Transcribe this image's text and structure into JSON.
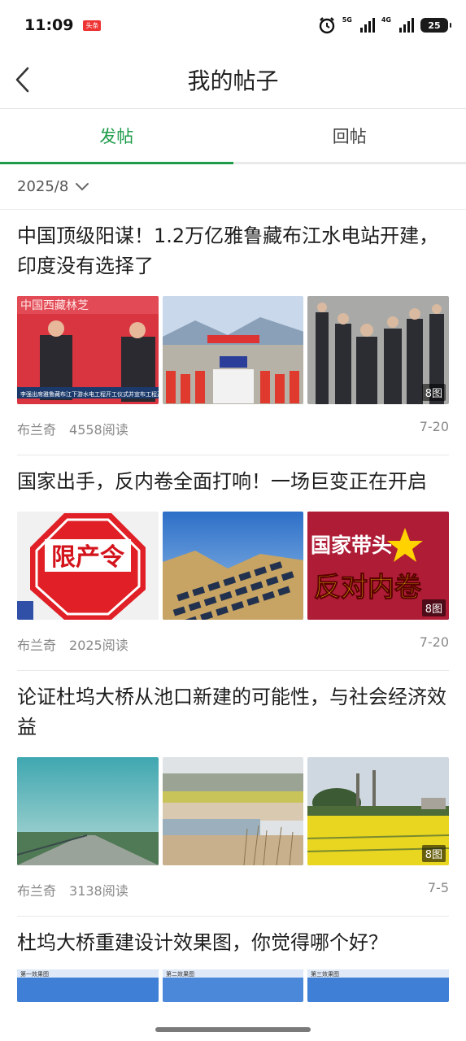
{
  "status": {
    "time": "11:09",
    "app_badge": "头条",
    "net1": "5G",
    "net2": "4G",
    "battery": "25"
  },
  "nav": {
    "title": "我的帖子"
  },
  "tabs": [
    {
      "label": "发帖"
    },
    {
      "label": "回帖"
    }
  ],
  "filter": {
    "date": "2025/8"
  },
  "posts": [
    {
      "title": "中国顶级阳谋！1.2万亿雅鲁藏布江水电站开建，印度没有选择了",
      "author": "布兰奇",
      "reads": "4558阅读",
      "date": "7-20",
      "image_count": "8图",
      "thumb_texts": [
        "中国西藏林芝",
        "李强出席雅鲁藏布江下游水电工程开工仪式并宣布工程开",
        "",
        "",
        ""
      ]
    },
    {
      "title": "国家出手，反内卷全面打响！一场巨变正在开启",
      "author": "布兰奇",
      "reads": "2025阅读",
      "date": "7-20",
      "image_count": "8图",
      "thumb_texts": [
        "限产令",
        "国家带头",
        "反对内卷"
      ]
    },
    {
      "title": "论证杜坞大桥从池口新建的可能性，与社会经济效益",
      "author": "布兰奇",
      "reads": "3138阅读",
      "date": "7-5",
      "image_count": "8图"
    },
    {
      "title": "杜坞大桥重建设计效果图，你觉得哪个好？",
      "thumb_texts": [
        "第一效果图",
        "第二效果图",
        "第三效果图"
      ]
    }
  ]
}
